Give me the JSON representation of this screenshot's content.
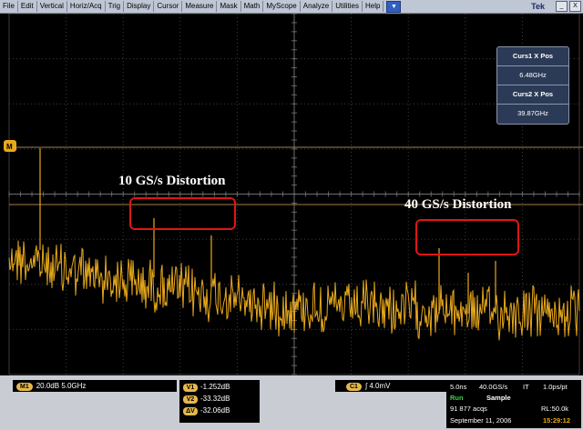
{
  "menu": {
    "items": [
      "File",
      "Edit",
      "Vertical",
      "Horiz/Acq",
      "Trig",
      "Display",
      "Cursor",
      "Measure",
      "Mask",
      "Math",
      "MyScope",
      "Analyze",
      "Utilities",
      "Help"
    ],
    "dropdown_glyph": "▼",
    "brand": "Tek",
    "window_buttons": [
      "_",
      "X"
    ]
  },
  "display": {
    "ref_marker": "M",
    "annotation_left": "10 GS/s Distortion",
    "annotation_right": "40 GS/s Distortion",
    "colors": {
      "trace": "#e8a91c",
      "grid": "#7a7a7a",
      "highlight_box": "#e01515",
      "cursor_line": "#c8a060"
    }
  },
  "cursor_panel": {
    "curs1_label": "Curs1 X Pos",
    "curs1_value": "6.48GHz",
    "curs2_label": "Curs2 X Pos",
    "curs2_value": "39.87GHz"
  },
  "bottom": {
    "math_badge": "M1",
    "math_scale": "20.0dB  5.0GHz",
    "cursor_readouts": [
      {
        "tag": "V1",
        "value": "-1.252dB"
      },
      {
        "tag": "V2",
        "value": "-33.32dB"
      },
      {
        "tag": "ΔV",
        "value": "-32.06dB"
      }
    ],
    "trigger_badge": "C1",
    "trigger_value": "∫ 4.0mV",
    "status": {
      "timebase": "5.0ns",
      "sample_rate": "40.0GS/s",
      "mode": "IT",
      "resolution": "1.0ps/pt",
      "run_state": "Run",
      "acq_mode": "Sample",
      "acqs": "91 877 acqs",
      "record_length": "RL:50.0k",
      "date": "September 11, 2006",
      "time": "15:29:12"
    }
  }
}
